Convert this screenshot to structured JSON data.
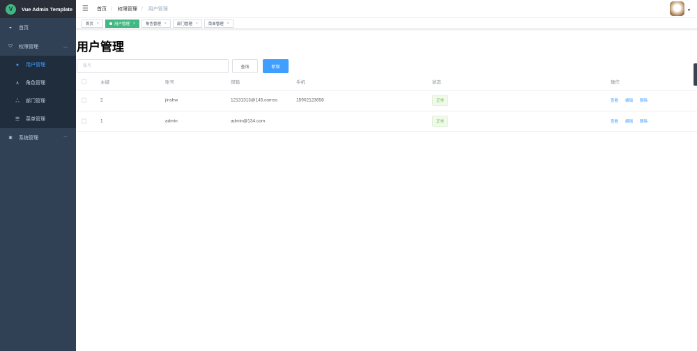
{
  "app": {
    "title": "Vue Admin Template",
    "logo_letter": "V"
  },
  "sidebar": {
    "items": [
      {
        "label": "首页",
        "icon": "dashboard-icon"
      },
      {
        "label": "权限管理",
        "icon": "shield-icon",
        "expanded": true,
        "children": [
          {
            "label": "用户管理",
            "icon": "user-icon",
            "active": true
          },
          {
            "label": "角色管理",
            "icon": "role-icon"
          },
          {
            "label": "部门管理",
            "icon": "tree-icon"
          },
          {
            "label": "菜单管理",
            "icon": "list-icon"
          }
        ]
      },
      {
        "label": "系统管理",
        "icon": "gear-icon"
      }
    ]
  },
  "header": {
    "breadcrumb": [
      "首页",
      "权限管理",
      "用户管理"
    ]
  },
  "tags": [
    {
      "label": "首页"
    },
    {
      "label": "用户管理",
      "active": true
    },
    {
      "label": "角色管理"
    },
    {
      "label": "部门管理"
    },
    {
      "label": "菜单管理"
    }
  ],
  "page": {
    "title": "用户管理",
    "search_placeholder": "账号",
    "query_label": "查询",
    "add_label": "新增"
  },
  "table": {
    "columns": [
      "主键",
      "账号",
      "邮箱",
      "手机",
      "状态",
      "操作"
    ],
    "rows": [
      {
        "id": "2",
        "account": "jinshw",
        "email": "12131313@145.comss",
        "phone": "15902123658",
        "status": "正常"
      },
      {
        "id": "1",
        "account": "admin",
        "email": "admin@134.com",
        "phone": "",
        "status": "正常"
      }
    ],
    "actions": [
      "查看",
      "编辑",
      "删除"
    ]
  }
}
